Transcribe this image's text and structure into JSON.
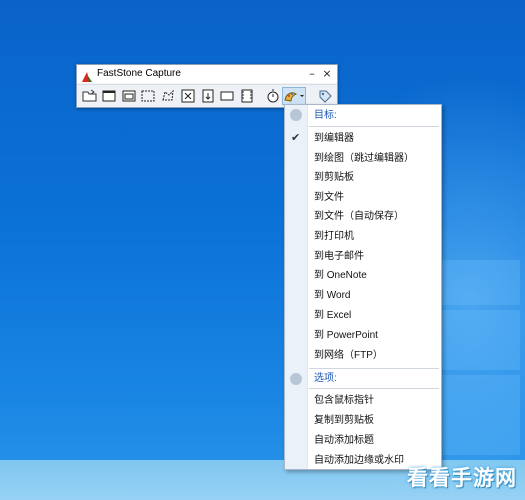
{
  "app": {
    "title": "FastStone Capture"
  },
  "window_buttons": [
    "–",
    "×"
  ],
  "toolbar": {
    "tools": [
      {
        "icon": "open-folder-icon"
      },
      {
        "icon": "capture-active-window-icon"
      },
      {
        "icon": "capture-window-object-icon"
      },
      {
        "icon": "capture-rectangle-icon"
      },
      {
        "icon": "capture-freehand-icon"
      },
      {
        "icon": "capture-fullscreen-icon"
      },
      {
        "icon": "capture-scrolling-icon"
      },
      {
        "icon": "capture-fixed-region-icon"
      },
      {
        "icon": "screen-recorder-icon"
      },
      {
        "icon": "delay-timer-icon"
      },
      {
        "icon": "output-destination-icon"
      },
      {
        "icon": "settings-tag-icon"
      }
    ]
  },
  "menu": {
    "target_header": "目标:",
    "targets": [
      {
        "label": "到编辑器",
        "checked": true
      },
      {
        "label": "到绘图（跳过编辑器）",
        "checked": false
      },
      {
        "label": "到剪贴板",
        "checked": false
      },
      {
        "label": "到文件",
        "checked": false
      },
      {
        "label": "到文件（自动保存）",
        "checked": false
      },
      {
        "label": "到打印机",
        "checked": false
      },
      {
        "label": "到电子邮件",
        "checked": false
      },
      {
        "label": "到 OneNote",
        "checked": false
      },
      {
        "label": "到 Word",
        "checked": false
      },
      {
        "label": "到 Excel",
        "checked": false
      },
      {
        "label": "到 PowerPoint",
        "checked": false
      },
      {
        "label": "到网络（FTP）",
        "checked": false
      }
    ],
    "options_header": "选项:",
    "options": [
      {
        "label": "包含鼠标指针"
      },
      {
        "label": "复制到剪贴板"
      },
      {
        "label": "自动添加标题"
      },
      {
        "label": "自动添加边缘或水印"
      }
    ]
  },
  "watermark": "看看手游网",
  "colors": {
    "desktop": "#0b72d8",
    "menu_header": "#1a56b5",
    "gutter": "#eaf1f8"
  }
}
